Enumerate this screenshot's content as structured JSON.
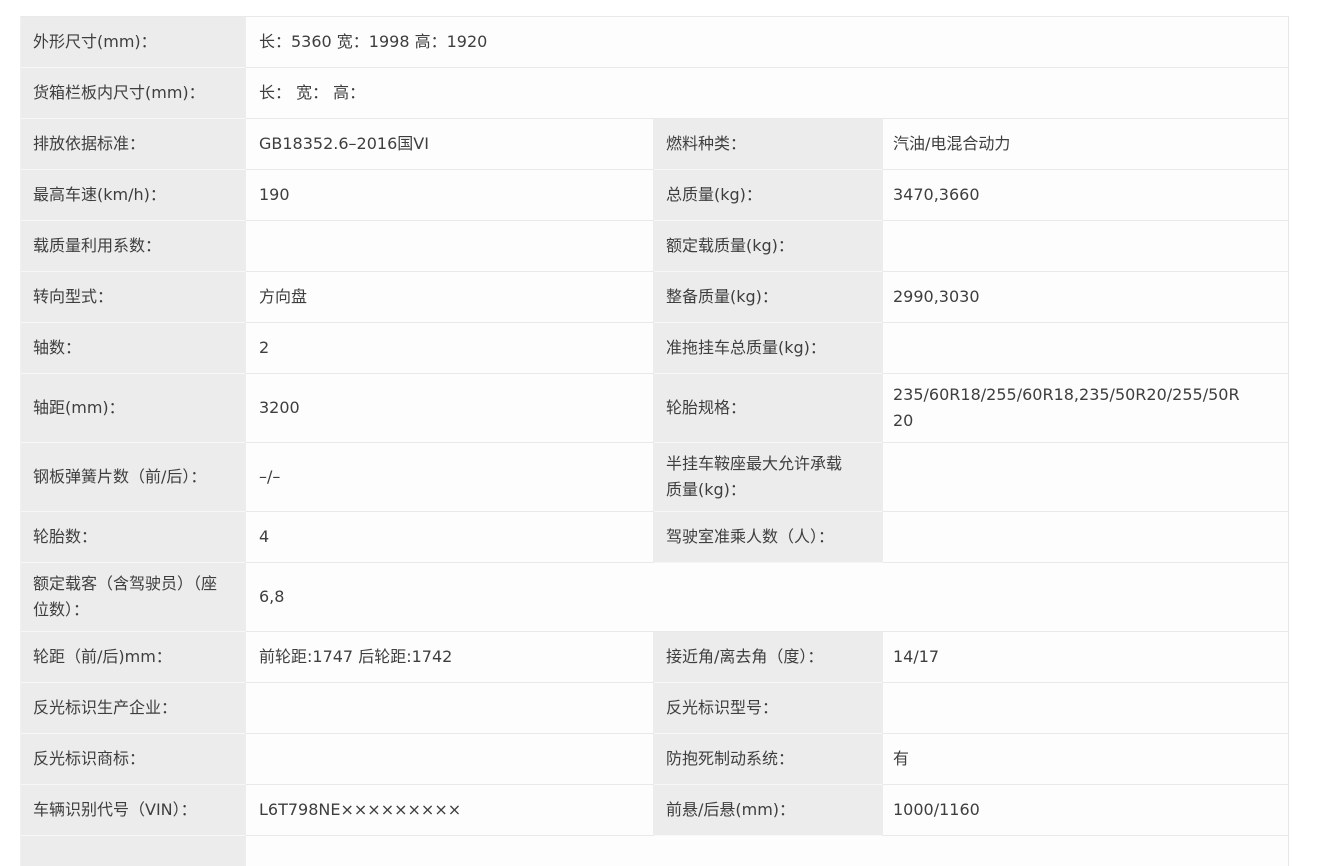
{
  "colors": {
    "label_bg": "#ececec",
    "value_bg": "#fdfdfd",
    "border": "#e9e9e9",
    "text": "#3e3e3e"
  },
  "table": {
    "rows": [
      {
        "type": "full",
        "label": "外形尺寸(mm)：",
        "value": "长：5360 宽：1998 高：1920"
      },
      {
        "type": "full",
        "label": "货箱栏板内尺寸(mm)：",
        "value": "长： 宽： 高："
      },
      {
        "type": "split",
        "label1": "排放依据标准：",
        "value1": "GB18352.6–2016国VI",
        "label2": "燃料种类：",
        "value2": "汽油/电混合动力"
      },
      {
        "type": "split",
        "label1": "最高车速(km/h)：",
        "value1": "190",
        "label2": "总质量(kg)：",
        "value2": "3470,3660"
      },
      {
        "type": "split",
        "label1": "载质量利用系数：",
        "value1": "",
        "label2": "额定载质量(kg)：",
        "value2": ""
      },
      {
        "type": "split",
        "label1": "转向型式：",
        "value1": "方向盘",
        "label2": "整备质量(kg)：",
        "value2": "2990,3030"
      },
      {
        "type": "split",
        "label1": "轴数：",
        "value1": "2",
        "label2": "准拖挂车总质量(kg)：",
        "value2": ""
      },
      {
        "type": "split",
        "label1": "轴距(mm)：",
        "value1": "3200",
        "label2": "轮胎规格：",
        "value2": "235/60R18/255/60R18,235/50R20/255/50R20"
      },
      {
        "type": "split",
        "label1": "钢板弹簧片数（前/后）：",
        "value1": "–/–",
        "label2": "半挂车鞍座最大允许承载质量(kg)：",
        "value2": ""
      },
      {
        "type": "split",
        "label1": "轮胎数：",
        "value1": "4",
        "label2": "驾驶室准乘人数（人）：",
        "value2": ""
      },
      {
        "type": "full",
        "label": "额定载客（含驾驶员）（座位数）：",
        "value": "6,8"
      },
      {
        "type": "split",
        "label1": "轮距（前/后)mm：",
        "value1": "前轮距:1747 后轮距:1742",
        "label2": "接近角/离去角（度）：",
        "value2": "14/17"
      },
      {
        "type": "split",
        "label1": "反光标识生产企业：",
        "value1": "",
        "label2": "反光标识型号：",
        "value2": ""
      },
      {
        "type": "split",
        "label1": "反光标识商标：",
        "value1": "",
        "label2": "防抱死制动系统：",
        "value2": "有"
      },
      {
        "type": "split",
        "label1": "车辆识别代号（VIN）：",
        "value1": "L6T798NE×××××××××",
        "label2": "前悬/后悬(mm)：",
        "value2": "1000/1160"
      },
      {
        "type": "partial",
        "label": "",
        "value": ""
      }
    ]
  }
}
